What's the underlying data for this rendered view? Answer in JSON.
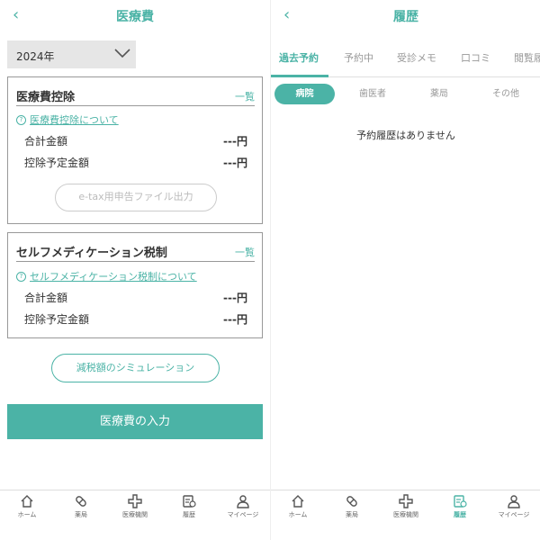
{
  "left": {
    "header": {
      "back": "‹",
      "title": "医療費"
    },
    "year_select": {
      "value": "2024年"
    },
    "deduction": {
      "title": "医療費控除",
      "list_link": "一覧",
      "info_icon": "?",
      "info": "医療費控除について",
      "total_label": "合計金額",
      "total_value": "---円",
      "planned_label": "控除予定金額",
      "planned_value": "---円",
      "etax_button": "e-tax用申告ファイル出力"
    },
    "self_med": {
      "title": "セルフメディケーション税制",
      "list_link": "一覧",
      "info_icon": "?",
      "info": "セルフメディケーション税制について",
      "total_label": "合計金額",
      "total_value": "---円",
      "planned_label": "控除予定金額",
      "planned_value": "---円"
    },
    "simulation_button": "減税額のシミュレーション",
    "input_button": "医療費の入力"
  },
  "right": {
    "header": {
      "back": "‹",
      "title": "履歴"
    },
    "tabs": [
      "過去予約",
      "予約中",
      "受診メモ",
      "口コミ",
      "閲覧履"
    ],
    "active_tab": 0,
    "chips": [
      "病院",
      "歯医者",
      "薬局",
      "その他"
    ],
    "active_chip": 0,
    "empty_message": "予約履歴はありません"
  },
  "tabbar": {
    "items": [
      {
        "label": "ホーム",
        "icon": "home-icon"
      },
      {
        "label": "薬局",
        "icon": "pill-icon"
      },
      {
        "label": "医療機関",
        "icon": "medical-cross-icon"
      },
      {
        "label": "履歴",
        "icon": "history-icon"
      },
      {
        "label": "マイページ",
        "icon": "user-icon"
      }
    ],
    "left_active": -1,
    "right_active": 3
  },
  "colors": {
    "accent": "#4bb3a6",
    "border": "#999999",
    "muted": "#999999"
  }
}
